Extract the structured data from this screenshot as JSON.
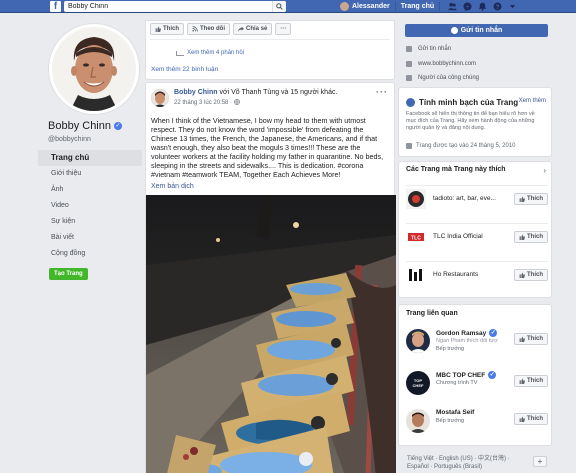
{
  "topbar": {
    "search_value": "Bobby Chinn",
    "user_name": "Alessander",
    "home_label": "Trang chủ"
  },
  "profile": {
    "name": "Bobby Chinn",
    "handle": "@bobbychinn"
  },
  "nav": {
    "items": [
      "Trang chủ",
      "Giới thiệu",
      "Ảnh",
      "Video",
      "Sự kiện",
      "Bài viết",
      "Cộng đồng"
    ],
    "create_page": "Tạo Trang"
  },
  "feed_top": {
    "actions": [
      "Thích",
      "Theo dõi",
      "Chia sẻ"
    ],
    "more_replies": "Xem thêm 4 phản hồi",
    "more_comments": "Xem thêm 22 bình luận"
  },
  "post": {
    "author": "Bobby Chinn",
    "with": "với Võ Thanh Tùng và 15 người khác.",
    "time": "22 tháng 3 lúc 20:58 · ",
    "text": "When I think of the Vietnamese, I bow my head to them with utmost respect. They do not know the word 'impossible' from defeating the Chinese 13 times, the French, the Japanese, the Americans, and if that wasn't enough, they also beat the moguls 3 times!!! These are the volunteer workers at the facility holding my father in quarantine. No beds, sleeping in the streets and sidewalks.... This is dedication. #corona #vietnam #teamwork TEAM, Together Each Achieves More!",
    "translate": "Xem bản dịch",
    "dots": "···"
  },
  "right": {
    "send_message": "Gửi tin nhắn",
    "info": [
      "Gửi tin nhắn",
      "www.bobbychinn.com",
      "Người của công chúng"
    ]
  },
  "transparency": {
    "title": "Tính minh bạch của Trang",
    "see_all": "Xem thêm",
    "body": "Facebook sẽ hiển thị thông tin để bạn hiểu rõ hơn về mục đích của Trang. Hãy xem hành động của những người quản lý và đăng nội dung.",
    "created": "Trang được tạo vào 24 tháng 5, 2010"
  },
  "liked": {
    "title": "Các Trang mà Trang này thích",
    "chevron": "›",
    "like_label": "Thích",
    "items": [
      {
        "name": "tadioto: art, bar, eve..."
      },
      {
        "name": "TLC India Official"
      },
      {
        "name": "Ho Restaurants"
      }
    ]
  },
  "related": {
    "title": "Trang liên quan",
    "like_label": "Thích",
    "items": [
      {
        "name": "Gordon Ramsay",
        "sub": "Ngan Pham thích đối tượng",
        "cat": "Bếp trưởng"
      },
      {
        "name": "MBC TOP CHEF",
        "sub": "",
        "cat": "Chương trình TV"
      },
      {
        "name": "Mostafa Seif",
        "sub": "",
        "cat": "Bếp trưởng"
      }
    ]
  },
  "footer": {
    "lang_line1": "Tiếng Việt · English (US) · 中文(台灣) ·",
    "lang_line2": "Español · Português (Brasil)",
    "plus": "+"
  }
}
